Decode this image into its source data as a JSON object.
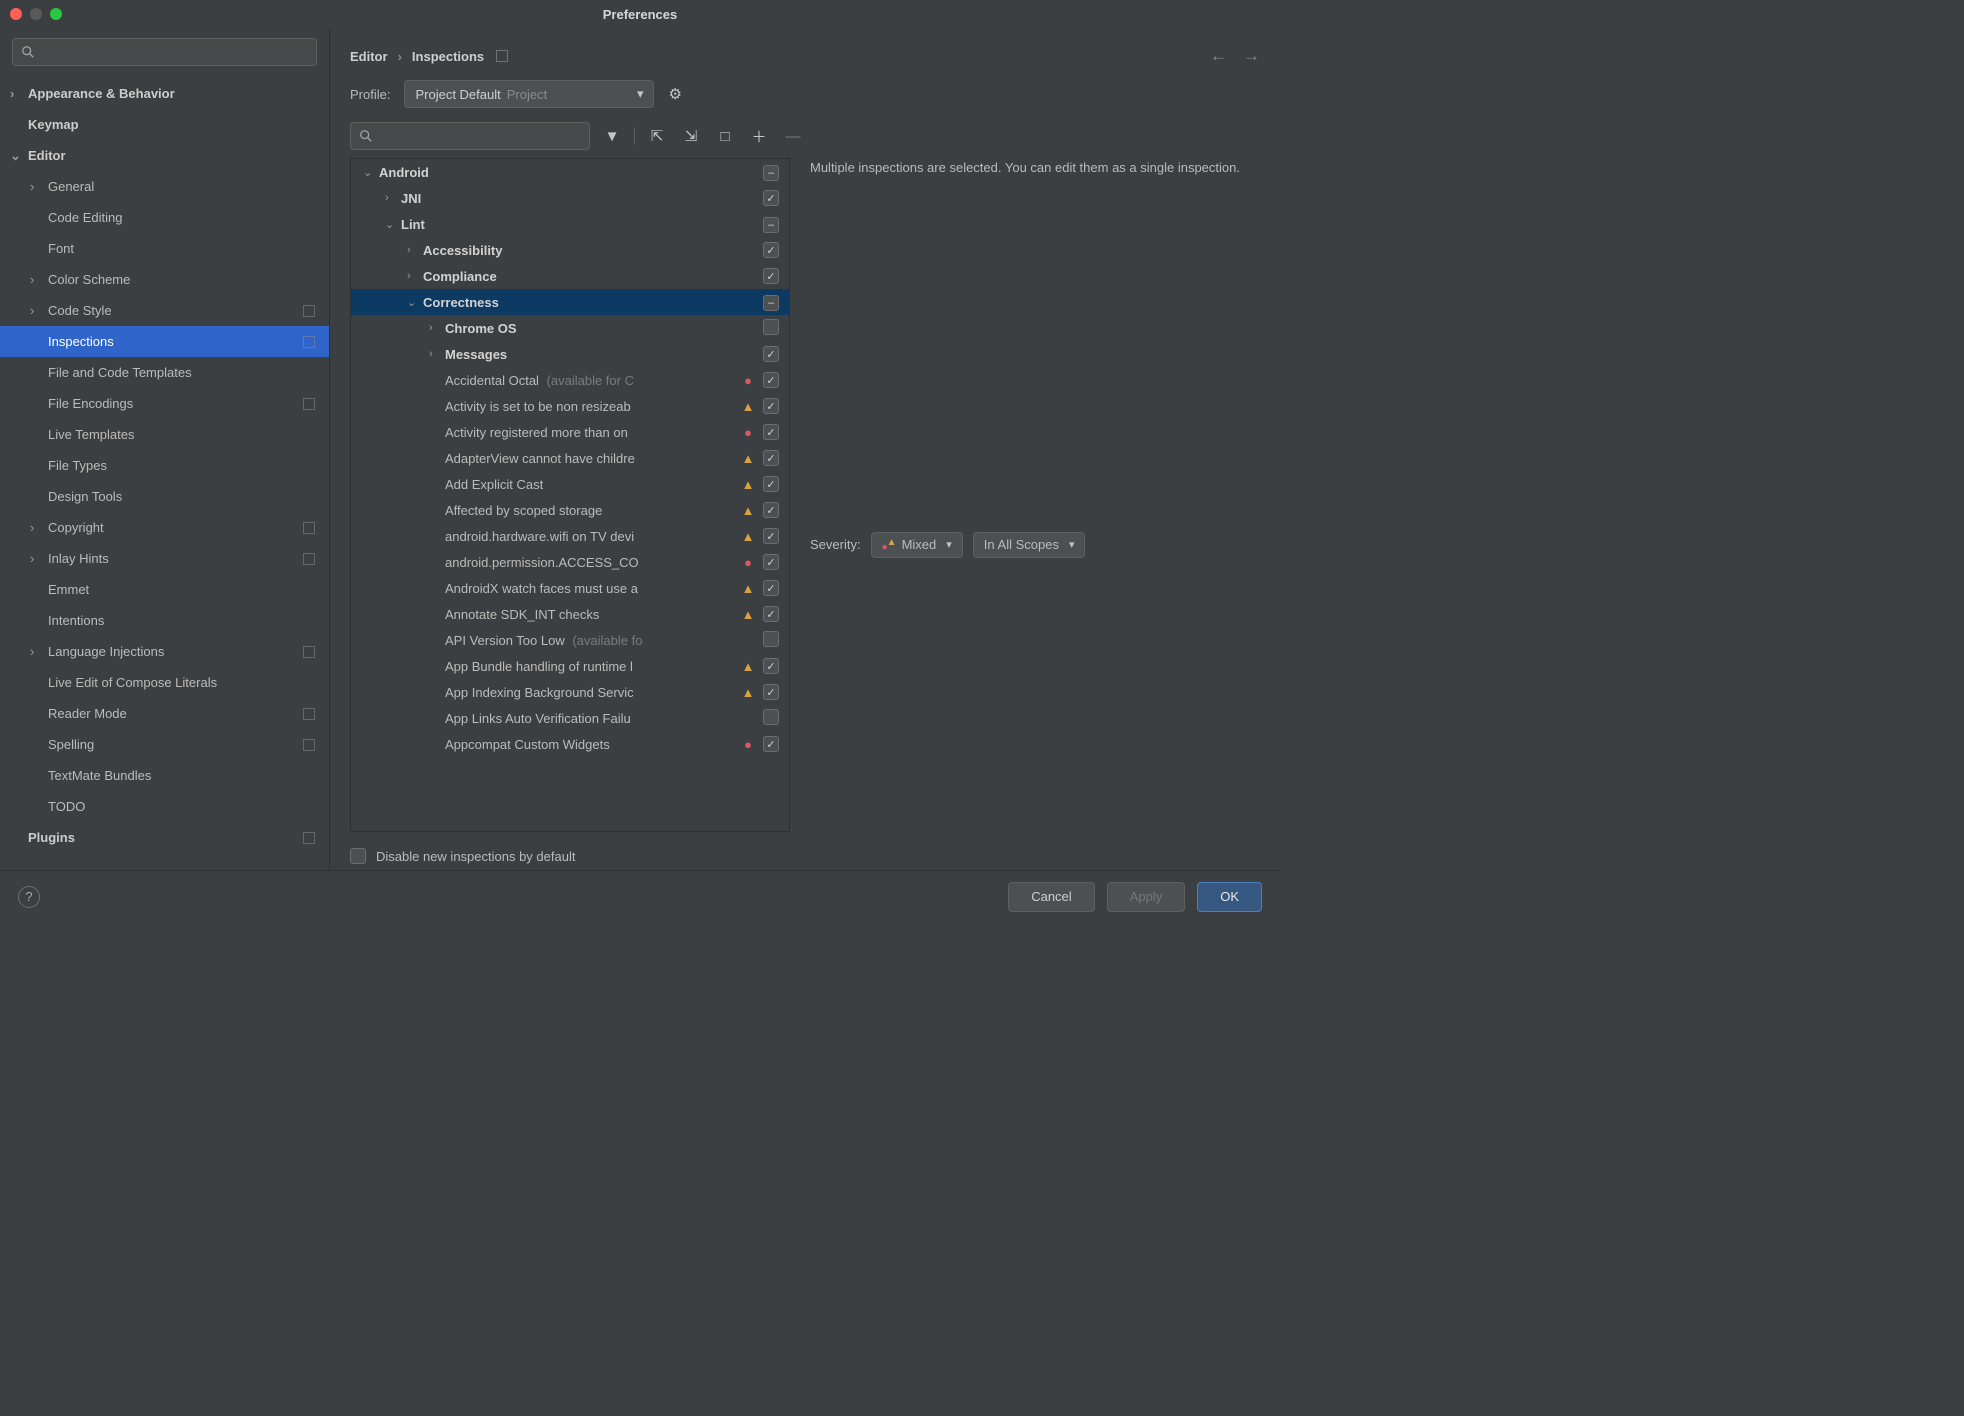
{
  "window": {
    "title": "Preferences"
  },
  "search": {
    "placeholder": ""
  },
  "sidebar": {
    "items": [
      {
        "label": "Appearance & Behavior",
        "bold": true,
        "chev": "›",
        "ind": 0
      },
      {
        "label": "Keymap",
        "bold": true,
        "ind": 0
      },
      {
        "label": "Editor",
        "bold": true,
        "chev": "⌄",
        "ind": 0
      },
      {
        "label": "General",
        "chev": "›",
        "ind": 1
      },
      {
        "label": "Code Editing",
        "ind": 1
      },
      {
        "label": "Font",
        "ind": 1
      },
      {
        "label": "Color Scheme",
        "chev": "›",
        "ind": 1
      },
      {
        "label": "Code Style",
        "chev": "›",
        "ind": 1,
        "proj": true
      },
      {
        "label": "Inspections",
        "ind": 1,
        "proj": true,
        "selected": true
      },
      {
        "label": "File and Code Templates",
        "ind": 1
      },
      {
        "label": "File Encodings",
        "ind": 1,
        "proj": true
      },
      {
        "label": "Live Templates",
        "ind": 1
      },
      {
        "label": "File Types",
        "ind": 1
      },
      {
        "label": "Design Tools",
        "ind": 1
      },
      {
        "label": "Copyright",
        "chev": "›",
        "ind": 1,
        "proj": true
      },
      {
        "label": "Inlay Hints",
        "chev": "›",
        "ind": 1,
        "proj": true
      },
      {
        "label": "Emmet",
        "ind": 1
      },
      {
        "label": "Intentions",
        "ind": 1
      },
      {
        "label": "Language Injections",
        "chev": "›",
        "ind": 1,
        "proj": true
      },
      {
        "label": "Live Edit of Compose Literals",
        "ind": 1
      },
      {
        "label": "Reader Mode",
        "ind": 1,
        "proj": true
      },
      {
        "label": "Spelling",
        "ind": 1,
        "proj": true
      },
      {
        "label": "TextMate Bundles",
        "ind": 1
      },
      {
        "label": "TODO",
        "ind": 1
      },
      {
        "label": "Plugins",
        "bold": true,
        "ind": 0,
        "proj": true
      }
    ]
  },
  "breadcrumb": {
    "a": "Editor",
    "b": "Inspections"
  },
  "profile": {
    "label": "Profile:",
    "value": "Project Default",
    "hint": "Project"
  },
  "inspTree": [
    {
      "label": "Android",
      "bold": true,
      "chev": "⌄",
      "indent": 0,
      "chk": "mixed"
    },
    {
      "label": "JNI",
      "bold": true,
      "chev": "›",
      "indent": 1,
      "chk": "checked"
    },
    {
      "label": "Lint",
      "bold": true,
      "chev": "⌄",
      "indent": 1,
      "chk": "mixed"
    },
    {
      "label": "Accessibility",
      "bold": true,
      "chev": "›",
      "indent": 2,
      "chk": "checked"
    },
    {
      "label": "Compliance",
      "bold": true,
      "chev": "›",
      "indent": 2,
      "chk": "checked"
    },
    {
      "label": "Correctness",
      "bold": true,
      "chev": "⌄",
      "indent": 2,
      "chk": "mixed",
      "sel": true
    },
    {
      "label": "Chrome OS",
      "bold": true,
      "chev": "›",
      "indent": 3,
      "chk": ""
    },
    {
      "label": "Messages",
      "bold": true,
      "chev": "›",
      "indent": 3,
      "chk": "checked"
    },
    {
      "label": "Accidental Octal",
      "hint": "(available for C",
      "indent": 3,
      "sev": "err",
      "chk": "checked"
    },
    {
      "label": "Activity is set to be non resizeab",
      "indent": 3,
      "sev": "warn",
      "chk": "checked"
    },
    {
      "label": "Activity registered more than on",
      "indent": 3,
      "sev": "err",
      "chk": "checked"
    },
    {
      "label": "AdapterView cannot have childre",
      "indent": 3,
      "sev": "warn",
      "chk": "checked"
    },
    {
      "label": "Add Explicit Cast",
      "indent": 3,
      "sev": "warn",
      "chk": "checked"
    },
    {
      "label": "Affected by scoped storage",
      "indent": 3,
      "sev": "warn",
      "chk": "checked"
    },
    {
      "label": "android.hardware.wifi on TV devi",
      "indent": 3,
      "sev": "warn",
      "chk": "checked"
    },
    {
      "label": "android.permission.ACCESS_CO",
      "indent": 3,
      "sev": "err",
      "chk": "checked"
    },
    {
      "label": "AndroidX watch faces must use a",
      "indent": 3,
      "sev": "warn",
      "chk": "checked"
    },
    {
      "label": "Annotate SDK_INT checks",
      "indent": 3,
      "sev": "warn",
      "chk": "checked"
    },
    {
      "label": "API Version Too Low",
      "hint": "(available fo",
      "indent": 3,
      "chk": ""
    },
    {
      "label": "App Bundle handling of runtime l",
      "indent": 3,
      "sev": "warn",
      "chk": "checked"
    },
    {
      "label": "App Indexing Background Servic",
      "indent": 3,
      "sev": "warn",
      "chk": "checked"
    },
    {
      "label": "App Links Auto Verification Failu",
      "indent": 3,
      "chk": ""
    },
    {
      "label": "Appcompat Custom Widgets",
      "indent": 3,
      "sev": "err",
      "chk": "checked"
    }
  ],
  "rightPanel": {
    "message": "Multiple inspections are selected. You can edit them as a single inspection.",
    "severityLabel": "Severity:",
    "severityValue": "Mixed",
    "scopeValue": "In All Scopes"
  },
  "disableRow": {
    "label": "Disable new inspections by default"
  },
  "buttons": {
    "cancel": "Cancel",
    "apply": "Apply",
    "ok": "OK"
  }
}
